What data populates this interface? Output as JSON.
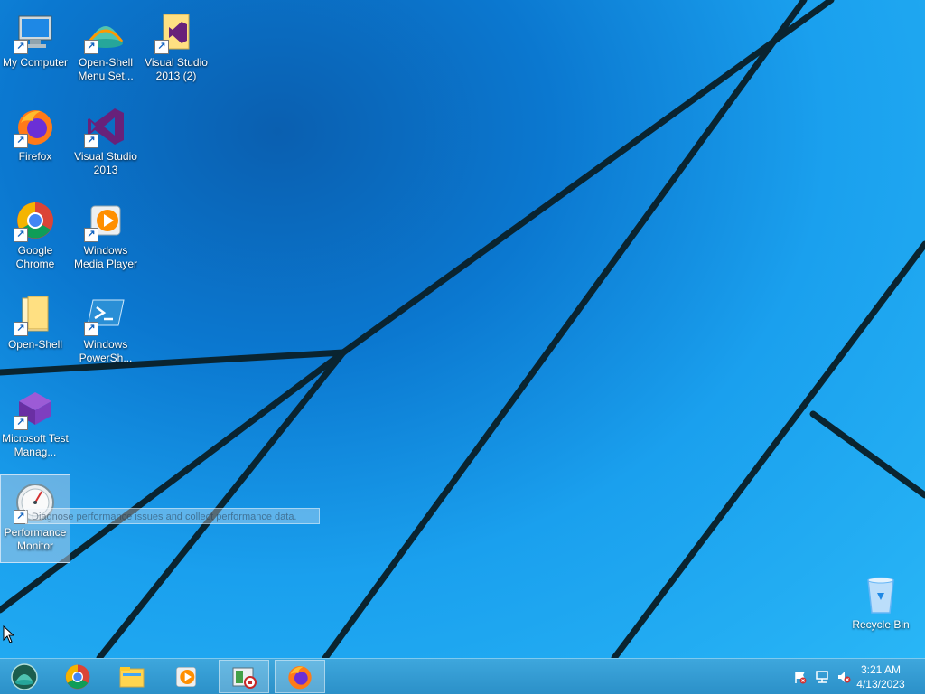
{
  "desktop": {
    "icons": [
      {
        "label": "My Computer",
        "icon": "computer-icon"
      },
      {
        "label": "Open-Shell Menu Set...",
        "icon": "open-shell-icon"
      },
      {
        "label": "Visual Studio 2013 (2)",
        "icon": "visual-studio-folder-icon"
      },
      {
        "label": "Firefox",
        "icon": "firefox-icon"
      },
      {
        "label": "Visual Studio 2013",
        "icon": "visual-studio-icon"
      },
      {
        "label": "Google Chrome",
        "icon": "chrome-icon"
      },
      {
        "label": "Windows Media Player",
        "icon": "media-player-icon"
      },
      {
        "label": "Open-Shell",
        "icon": "folder-icon"
      },
      {
        "label": "Windows PowerSh...",
        "icon": "powershell-icon"
      },
      {
        "label": "Microsoft Test Manag...",
        "icon": "test-manager-icon"
      },
      {
        "label": "Performance Monitor",
        "icon": "performance-monitor-icon"
      },
      {
        "label": "Recycle Bin",
        "icon": "recycle-bin-icon"
      }
    ],
    "tooltip": "Diagnose performance issues and collect performance data."
  },
  "taskbar": {
    "start": {
      "icon": "open-shell-start-icon"
    },
    "pinned": [
      {
        "name": "Google Chrome",
        "icon": "chrome-icon"
      },
      {
        "name": "File Explorer",
        "icon": "file-explorer-icon"
      },
      {
        "name": "Windows Media Player",
        "icon": "media-player-icon"
      },
      {
        "name": "Performance Monitor (running)",
        "icon": "recorder-icon"
      },
      {
        "name": "Firefox (running)",
        "icon": "firefox-icon"
      }
    ],
    "tray": {
      "icons": [
        "action-center-flag-icon",
        "network-icon",
        "volume-muted-icon"
      ],
      "time": "3:21 AM",
      "date": "4/13/2023"
    }
  },
  "colors": {
    "taskbar": "#2b90c8",
    "desktop_accent": "#1aa0ee"
  }
}
